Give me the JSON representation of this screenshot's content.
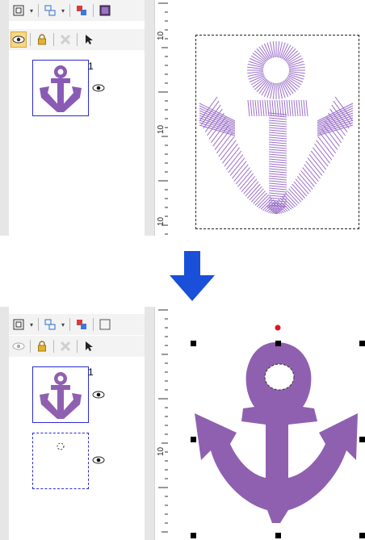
{
  "top_panel": {
    "layer_number": "1",
    "ruler_labels": [
      "10",
      "10",
      "10"
    ]
  },
  "bottom_panel": {
    "layer_number": "1",
    "ruler_labels": [
      "10"
    ]
  },
  "colors": {
    "embroidery_purple": "#9b6fc9",
    "fill_purple": "#8f60b0",
    "arrow_blue": "#1a4fd9",
    "selection_red": "#e0141e"
  },
  "icons": [
    "fit-page-icon",
    "layers-icon",
    "color-order-icon",
    "frame-icon",
    "eye-icon",
    "lock-icon",
    "delete-icon",
    "select-arrow-icon"
  ]
}
